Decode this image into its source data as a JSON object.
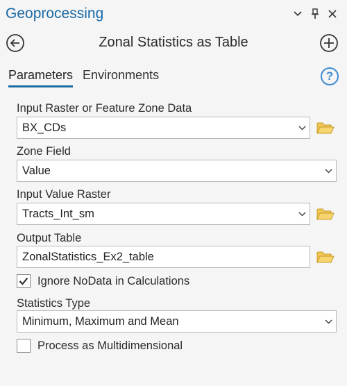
{
  "pane": {
    "title": "Geoprocessing",
    "colors": {
      "title": "#1a6aa6",
      "accent": "#1a6aa6",
      "folder": "#e8b93a"
    }
  },
  "tool": {
    "title": "Zonal Statistics as Table"
  },
  "tabs": [
    {
      "label": "Parameters",
      "active": true
    },
    {
      "label": "Environments",
      "active": false
    }
  ],
  "help": {
    "glyph": "?"
  },
  "params": {
    "input_zone": {
      "label": "Input Raster or Feature Zone Data",
      "value": "BX_CDs"
    },
    "zone_field": {
      "label": "Zone Field",
      "value": "Value"
    },
    "input_value": {
      "label": "Input Value Raster",
      "value": "Tracts_Int_sm"
    },
    "output_table": {
      "label": "Output Table",
      "value": "ZonalStatistics_Ex2_table"
    },
    "ignore_nodata": {
      "label": "Ignore NoData in Calculations",
      "checked": true
    },
    "statistics_type": {
      "label": "Statistics Type",
      "value": "Minimum, Maximum and Mean"
    },
    "multidimensional": {
      "label": "Process as Multidimensional",
      "checked": false
    }
  }
}
